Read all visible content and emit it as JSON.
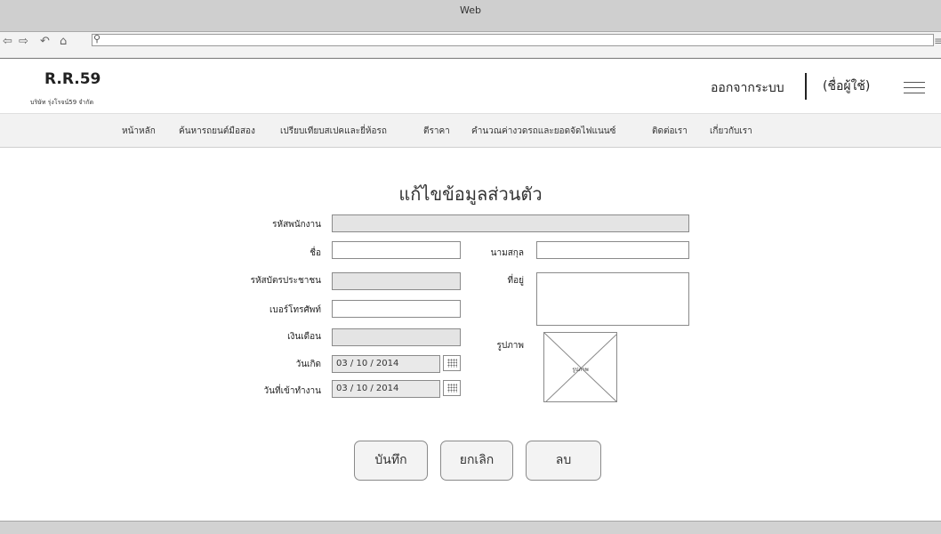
{
  "window": {
    "title": "Web"
  },
  "browser": {
    "url": ""
  },
  "header": {
    "brand": "R.R.59",
    "company": "บริษัท รุ่งโรจน์59 จำกัด",
    "logout": "ออกจากระบบ",
    "username": "(ชื่อผู้ใช้)"
  },
  "nav": {
    "items": [
      {
        "label": "หน้าหลัก"
      },
      {
        "label": "ค้นหารถยนต์มือสอง"
      },
      {
        "label": "เปรียบเทียบสเปคและยี่ห้อรถ"
      },
      {
        "label": "ตีราคา"
      },
      {
        "label": "คำนวณค่างวดรถและยอดจัดไฟแนนซ์"
      },
      {
        "label": "ติดต่อเรา"
      },
      {
        "label": "เกี่ยวกับเรา"
      }
    ]
  },
  "form": {
    "title": "แก้ไขข้อมูลส่วนตัว",
    "employee_id": {
      "label": "รหัสพนักงาน",
      "value": ""
    },
    "first_name": {
      "label": "ชื่อ",
      "value": ""
    },
    "last_name": {
      "label": "นามสกุล",
      "value": ""
    },
    "citizen_id": {
      "label": "รหัสบัตรประชาชน",
      "value": ""
    },
    "address": {
      "label": "ที่อยู่",
      "value": ""
    },
    "phone": {
      "label": "เบอร์โทรศัพท์",
      "value": ""
    },
    "salary": {
      "label": "เงินเดือน",
      "value": ""
    },
    "photo": {
      "label": "รูปภาพ",
      "placeholder": "รูปภาพ"
    },
    "birth_date": {
      "label": "วันเกิด",
      "value": "03 / 10 / 2014"
    },
    "start_date": {
      "label": "วันที่เข้าทำงาน",
      "value": "03 / 10 / 2014"
    }
  },
  "buttons": {
    "save": "บันทึก",
    "cancel": "ยกเลิก",
    "delete": "ลบ"
  },
  "icons": [
    "back-arrow-icon",
    "forward-arrow-icon",
    "reload-icon",
    "home-icon",
    "search-icon",
    "calendar-icon",
    "hamburger-menu-icon",
    "image-placeholder-icon"
  ]
}
